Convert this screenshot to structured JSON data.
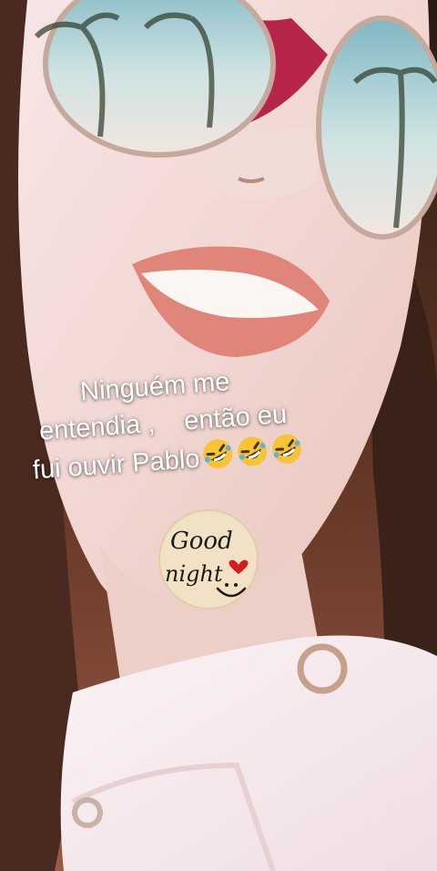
{
  "caption": {
    "line1": "Ninguém me",
    "line2": "entendia ,    então eu",
    "line3": "fui ouvir Pablo",
    "emoji_icon": "rolling-on-floor-laughing-emoji",
    "emoji_count": 3
  },
  "sticker": {
    "word1": "Good",
    "word2": "night",
    "icons": [
      "heart-icon",
      "smiley-icon"
    ]
  },
  "colors": {
    "caption_text": "#ffffff",
    "lips": "#e0857a",
    "sunglasses_frame": "#b8254a",
    "sticker_bg": "#f1e2c6",
    "heart": "#d91a1a"
  }
}
